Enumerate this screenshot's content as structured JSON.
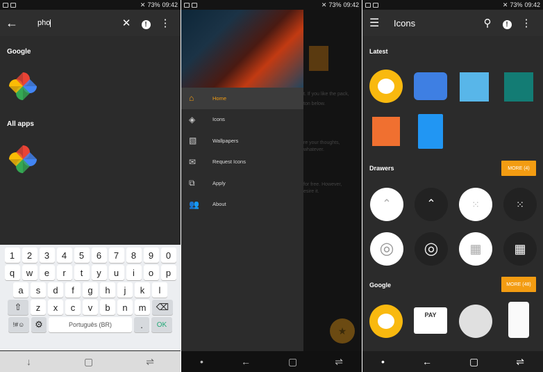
{
  "status": {
    "battery": "73%",
    "time": "09:42"
  },
  "search": {
    "query": "pho",
    "section_google": "Google",
    "section_all": "All apps"
  },
  "keyboard": {
    "row1": [
      "1",
      "2",
      "3",
      "4",
      "5",
      "6",
      "7",
      "8",
      "9",
      "0"
    ],
    "row2": [
      "q",
      "w",
      "e",
      "r",
      "t",
      "y",
      "u",
      "i",
      "o",
      "p"
    ],
    "row3": [
      "a",
      "s",
      "d",
      "f",
      "g",
      "h",
      "j",
      "k",
      "l"
    ],
    "row4": [
      "z",
      "x",
      "c",
      "v",
      "b",
      "n",
      "m"
    ],
    "symbols": "!#☺",
    "language": "Português (BR)",
    "period": ".",
    "ok": "OK"
  },
  "drawer": {
    "items": [
      {
        "label": "Home",
        "icon": "home-icon"
      },
      {
        "label": "Icons",
        "icon": "layers-icon"
      },
      {
        "label": "Wallpapers",
        "icon": "image-icon"
      },
      {
        "label": "Request Icons",
        "icon": "mail-icon"
      },
      {
        "label": "Apply",
        "icon": "apply-icon"
      },
      {
        "label": "About",
        "icon": "people-icon"
      }
    ],
    "bg_text": [
      "t. If you like the pack,",
      "ton below.",
      "re your thoughts,",
      "whatever.",
      "for free. However,",
      "esire it."
    ]
  },
  "icons": {
    "title": "Icons",
    "latest": "Latest",
    "drawers": "Drawers",
    "more_drawers": "MORE (4)",
    "google": "Google",
    "more_google": "MORE (48)",
    "google_icon_text": "PAY"
  },
  "colors": {
    "accent": "#f39c12",
    "toolbar": "#2e2e2e",
    "background": "#2b2b2b"
  }
}
